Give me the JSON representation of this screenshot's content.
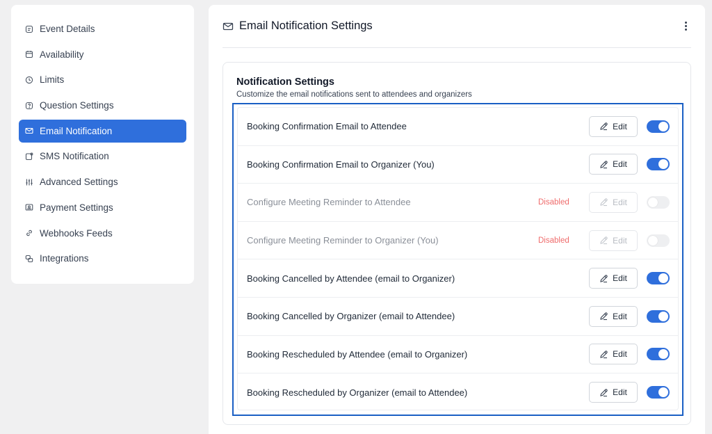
{
  "sidebar": {
    "items": [
      {
        "label": "Event Details",
        "icon": "calendar-details-icon",
        "active": false
      },
      {
        "label": "Availability",
        "icon": "calendar-icon",
        "active": false
      },
      {
        "label": "Limits",
        "icon": "clock-icon",
        "active": false
      },
      {
        "label": "Question Settings",
        "icon": "question-icon",
        "active": false
      },
      {
        "label": "Email Notification",
        "icon": "mail-icon",
        "active": true
      },
      {
        "label": "SMS Notification",
        "icon": "sms-icon",
        "active": false
      },
      {
        "label": "Advanced Settings",
        "icon": "sliders-icon",
        "active": false
      },
      {
        "label": "Payment Settings",
        "icon": "payment-card-icon",
        "active": false
      },
      {
        "label": "Webhooks Feeds",
        "icon": "link-icon",
        "active": false
      },
      {
        "label": "Integrations",
        "icon": "integrations-icon",
        "active": false
      }
    ]
  },
  "header": {
    "title": "Email Notification Settings",
    "icon": "mail-icon",
    "menu_icon": "kebab-menu-icon"
  },
  "card": {
    "title": "Notification Settings",
    "subtitle": "Customize the email notifications sent to attendees and organizers"
  },
  "notifications": [
    {
      "label": "Booking Confirmation Email to Attendee",
      "edit_label": "Edit",
      "enabled": true,
      "status": ""
    },
    {
      "label": "Booking Confirmation Email to Organizer (You)",
      "edit_label": "Edit",
      "enabled": true,
      "status": ""
    },
    {
      "label": "Configure Meeting Reminder to Attendee",
      "edit_label": "Edit",
      "enabled": false,
      "status": "Disabled"
    },
    {
      "label": "Configure Meeting Reminder to Organizer (You)",
      "edit_label": "Edit",
      "enabled": false,
      "status": "Disabled"
    },
    {
      "label": "Booking Cancelled by Attendee (email to Organizer)",
      "edit_label": "Edit",
      "enabled": true,
      "status": ""
    },
    {
      "label": "Booking Cancelled by Organizer (email to Attendee)",
      "edit_label": "Edit",
      "enabled": true,
      "status": ""
    },
    {
      "label": "Booking Rescheduled by Attendee (email to Organizer)",
      "edit_label": "Edit",
      "enabled": true,
      "status": ""
    },
    {
      "label": "Booking Rescheduled by Organizer (email to Attendee)",
      "edit_label": "Edit",
      "enabled": true,
      "status": ""
    }
  ],
  "colors": {
    "accent": "#2f6fdc",
    "highlight_border": "#1a5fc4",
    "disabled_text": "#ef6b6b"
  }
}
